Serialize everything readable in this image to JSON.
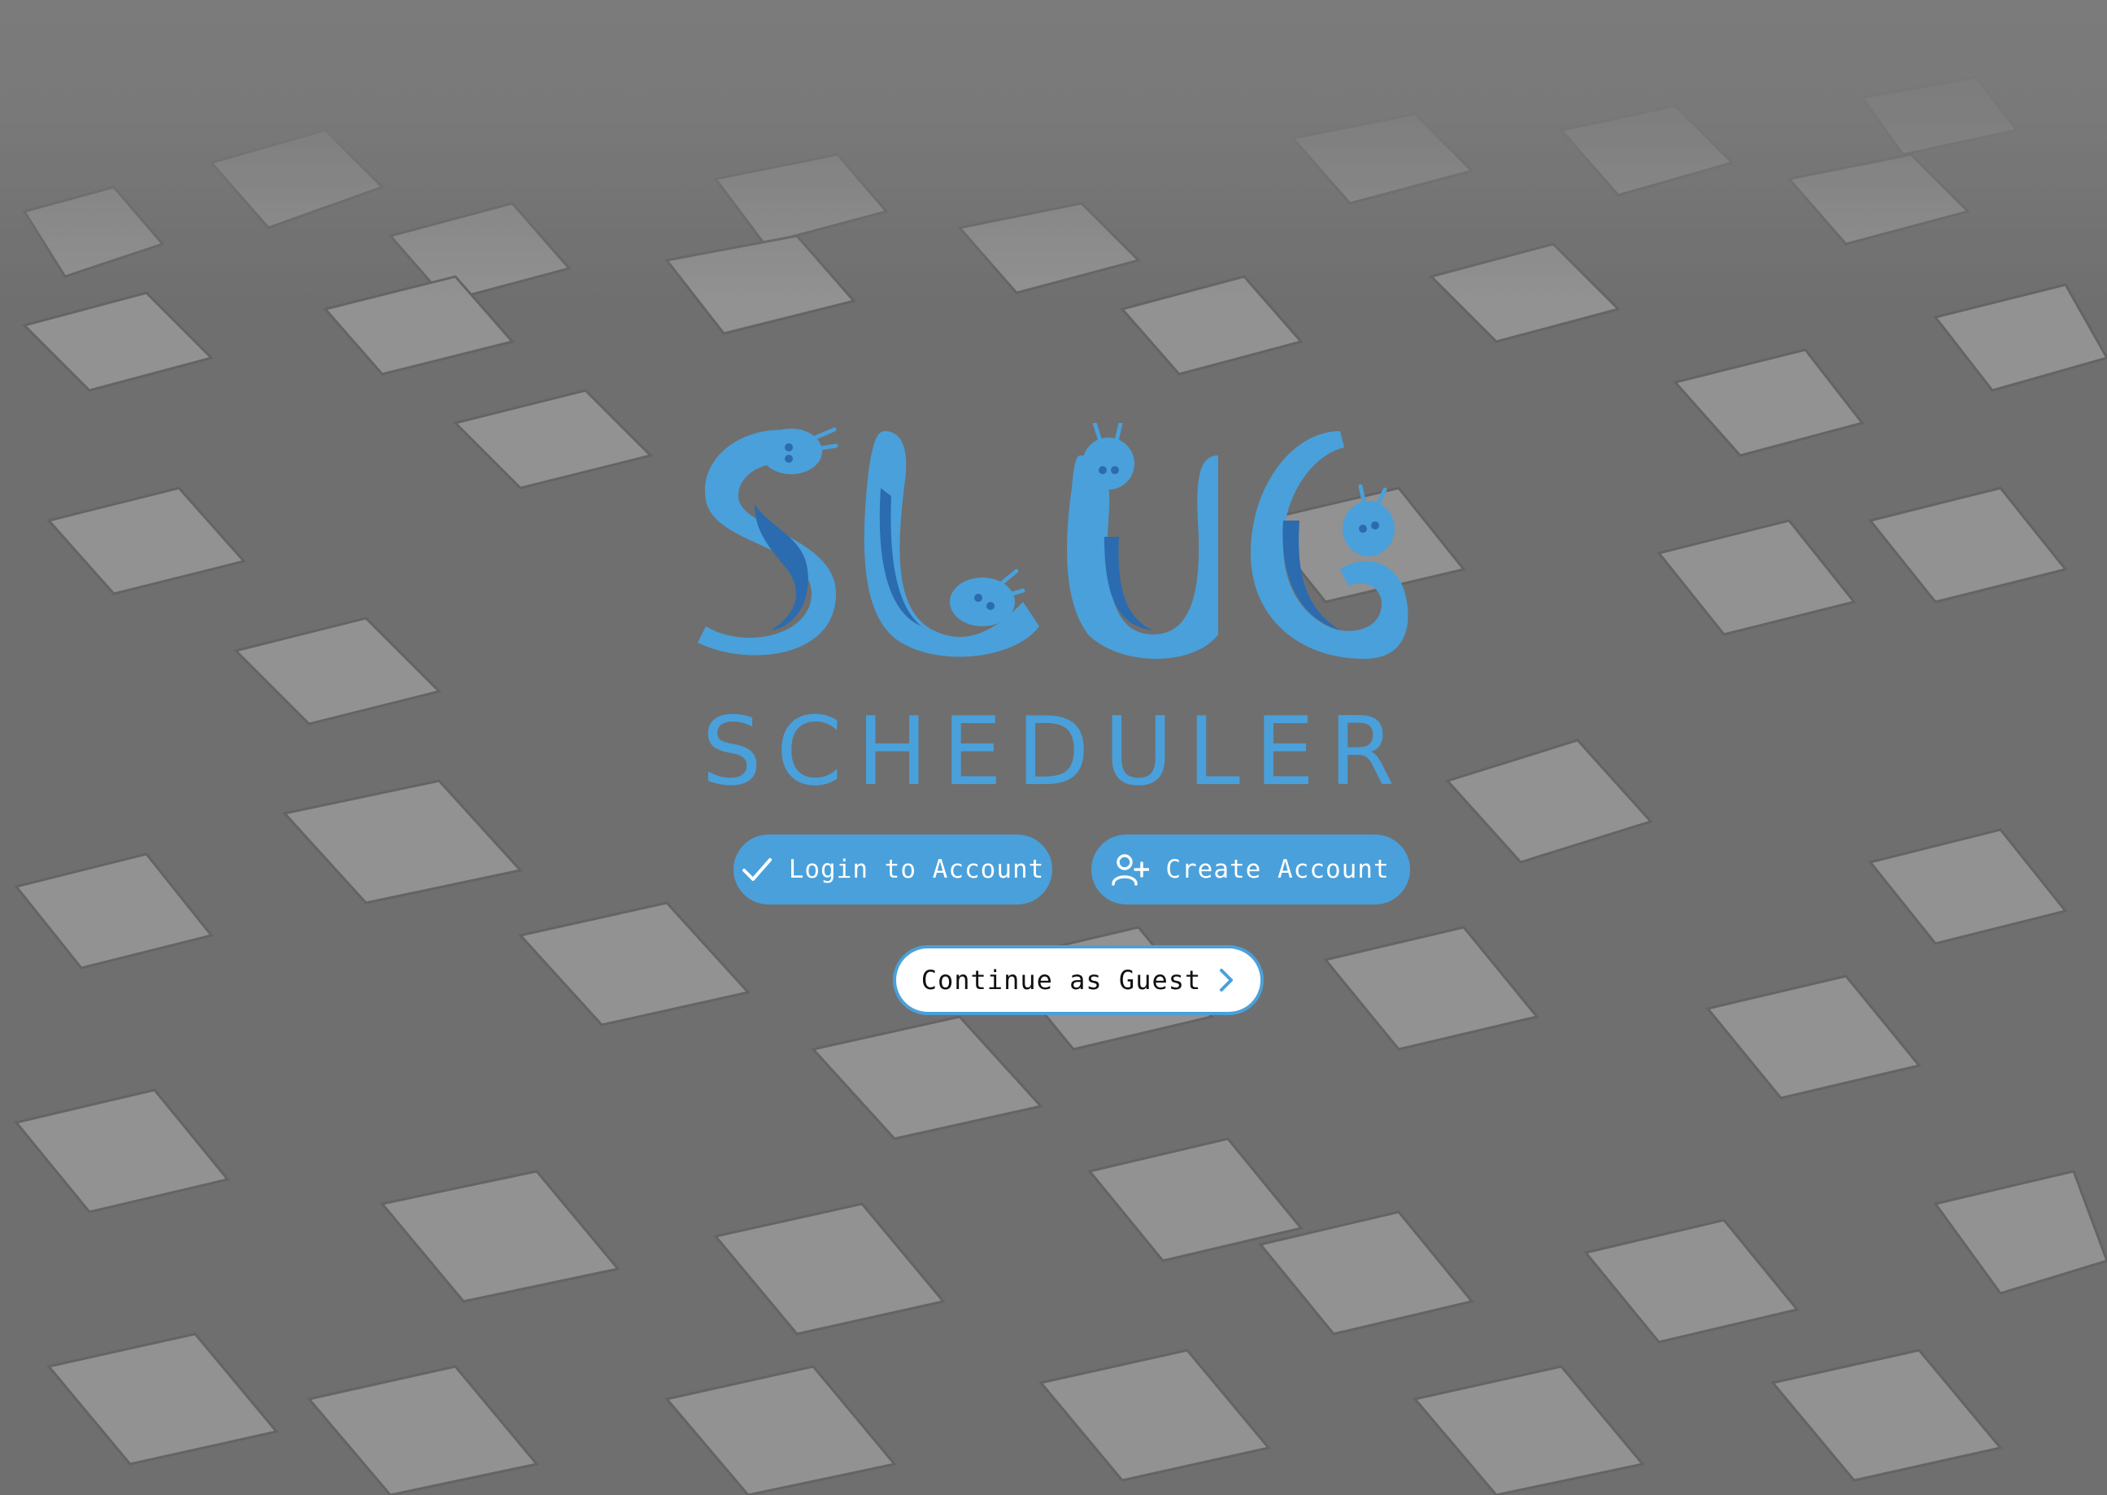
{
  "app": {
    "logo_text": "SLUG",
    "wordmark": "SCHEDULER"
  },
  "actions": {
    "login_label": "Login to Account",
    "create_label": "Create Account",
    "guest_label": "Continue as Guest"
  },
  "icons": {
    "login": "check-icon",
    "create": "add-user-icon",
    "guest": "chevron-right-icon"
  },
  "colors": {
    "accent": "#4aa0da",
    "accent_dark": "#2b6bb0",
    "overlay_gray": "#7a7a7a",
    "white": "#ffffff"
  }
}
